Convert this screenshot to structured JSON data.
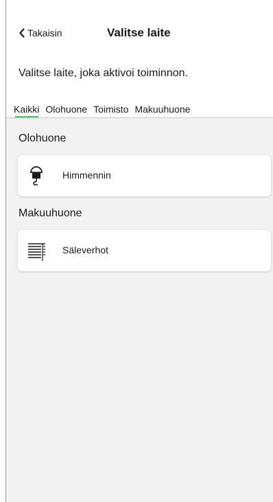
{
  "header": {
    "back_label": "Takaisin",
    "title": "Valitse laite"
  },
  "subtitle": "Valitse laite, joka aktivoi toiminnon.",
  "tabs": [
    {
      "label": "Kaikki",
      "active": true
    },
    {
      "label": "Olohuone",
      "active": false
    },
    {
      "label": "Toimisto",
      "active": false
    },
    {
      "label": "Makuuhuone",
      "active": false
    }
  ],
  "sections": [
    {
      "name": "Olohuone",
      "devices": [
        {
          "label": "Himmennin",
          "icon": "bulb-icon"
        }
      ]
    },
    {
      "name": "Makuuhuone",
      "devices": [
        {
          "label": "Säleverhot",
          "icon": "blinds-icon"
        }
      ]
    }
  ],
  "colors": {
    "accent": "#3dcd58",
    "background": "#f2f2f2",
    "card": "#ffffff"
  }
}
